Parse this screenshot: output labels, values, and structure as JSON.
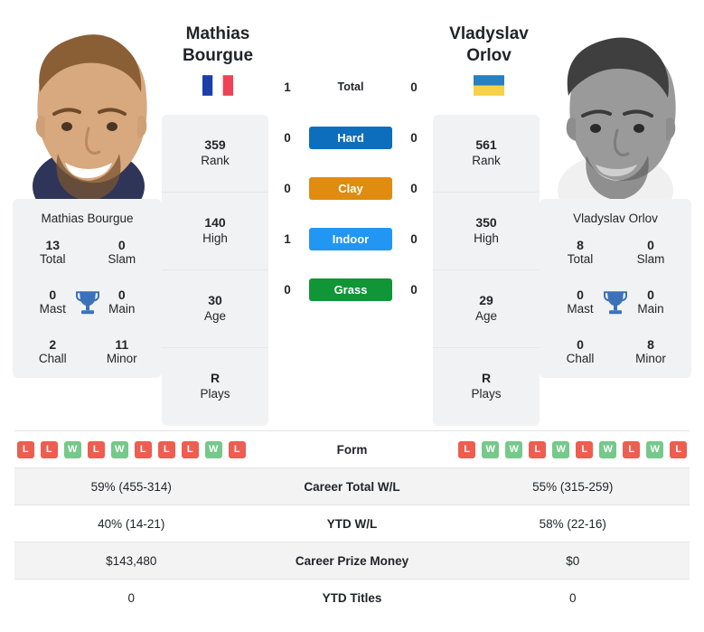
{
  "players": {
    "left": {
      "first_name": "Mathias",
      "last_name": "Bourgue",
      "full_name": "Mathias Bourgue",
      "flag": "france-flag",
      "photo": "player-photo-color",
      "rank": "359",
      "rank_label": "Rank",
      "high": "140",
      "high_label": "High",
      "age": "30",
      "age_label": "Age",
      "plays": "R",
      "plays_label": "Plays",
      "titles": {
        "total": "13",
        "total_label": "Total",
        "slam": "0",
        "slam_label": "Slam",
        "mast": "0",
        "mast_label": "Mast",
        "main": "0",
        "main_label": "Main",
        "chall": "2",
        "chall_label": "Chall",
        "minor": "11",
        "minor_label": "Minor"
      },
      "h2h": {
        "total": "1",
        "hard": "0",
        "clay": "0",
        "indoor": "1",
        "grass": "0"
      },
      "form": [
        "L",
        "L",
        "W",
        "L",
        "W",
        "L",
        "L",
        "L",
        "W",
        "L"
      ],
      "career_wl": "59% (455-314)",
      "ytd_wl": "40% (14-21)",
      "prize_money": "$143,480",
      "ytd_titles": "0"
    },
    "right": {
      "first_name": "Vladyslav",
      "last_name": "Orlov",
      "full_name": "Vladyslav Orlov",
      "flag": "ukraine-flag",
      "photo": "player-photo-grayscale",
      "rank": "561",
      "rank_label": "Rank",
      "high": "350",
      "high_label": "High",
      "age": "29",
      "age_label": "Age",
      "plays": "R",
      "plays_label": "Plays",
      "titles": {
        "total": "8",
        "total_label": "Total",
        "slam": "0",
        "slam_label": "Slam",
        "mast": "0",
        "mast_label": "Mast",
        "main": "0",
        "main_label": "Main",
        "chall": "0",
        "chall_label": "Chall",
        "minor": "8",
        "minor_label": "Minor"
      },
      "h2h": {
        "total": "0",
        "hard": "0",
        "clay": "0",
        "indoor": "0",
        "grass": "0"
      },
      "form": [
        "L",
        "W",
        "W",
        "L",
        "W",
        "L",
        "W",
        "L",
        "W",
        "L"
      ],
      "career_wl": "55% (315-259)",
      "ytd_wl": "58% (22-16)",
      "prize_money": "$0",
      "ytd_titles": "0"
    }
  },
  "surfaces": [
    {
      "label": "Total",
      "color": "transparent",
      "style": "plain"
    },
    {
      "label": "Hard",
      "color": "#0d6ebd",
      "style": "badge"
    },
    {
      "label": "Clay",
      "color": "#df8c10",
      "style": "badge"
    },
    {
      "label": "Indoor",
      "color": "#2196f3",
      "style": "badge"
    },
    {
      "label": "Grass",
      "color": "#109537",
      "style": "badge"
    }
  ],
  "table_rows": [
    {
      "label": "Form",
      "type": "form"
    },
    {
      "label": "Career Total W/L",
      "type": "text",
      "key": "career_wl"
    },
    {
      "label": "YTD W/L",
      "type": "text",
      "key": "ytd_wl"
    },
    {
      "label": "Career Prize Money",
      "type": "text",
      "key": "prize_money"
    },
    {
      "label": "YTD Titles",
      "type": "text",
      "key": "ytd_titles"
    }
  ],
  "colors": {
    "win": "#75c98a",
    "loss": "#ed5e50",
    "card_bg": "#f1f2f3",
    "row_alt": "#f3f3f4",
    "trophy": "#3b72b8"
  }
}
